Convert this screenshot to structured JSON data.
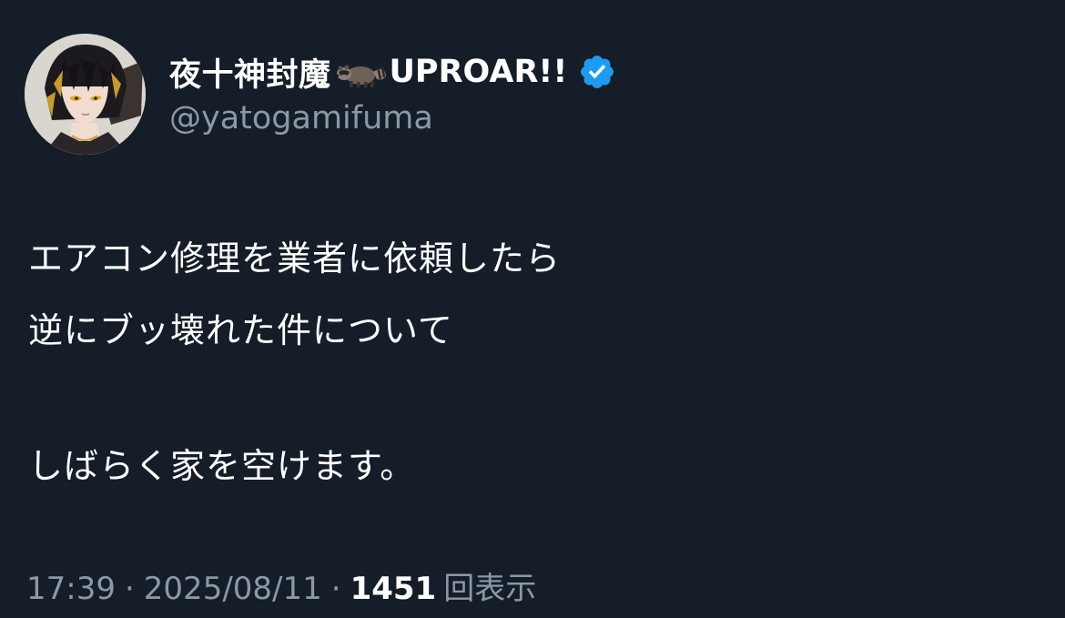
{
  "author": {
    "display_name": "夜十神封魔",
    "emoji_icon": "raccoon-icon",
    "display_name_suffix": "UPROAR!!",
    "verified_icon": "verified-badge-icon",
    "verified_color": "#1d9bf0",
    "handle": "@yatogamifuma"
  },
  "tweet": {
    "lines": [
      "エアコン修理を業者に依頼したら",
      "逆にブッ壊れた件について",
      "しばらく家を空けます。"
    ]
  },
  "meta": {
    "time": "17:39",
    "separator": "·",
    "date": "2025/08/11",
    "views_count": "1451",
    "views_label": "回表示"
  },
  "colors": {
    "background": "#151d28",
    "text_primary": "#ffffff",
    "text_secondary": "#8b98a5"
  }
}
